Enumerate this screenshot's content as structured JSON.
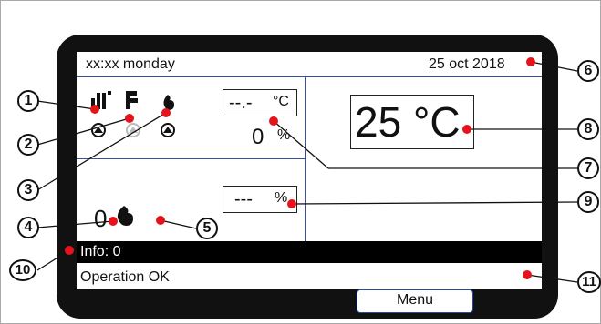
{
  "header": {
    "time_day": "xx:xx monday",
    "date": "25 oct 2018"
  },
  "left_panel": {
    "target_temp": "--.-",
    "target_temp_unit": "°C",
    "modulation_value": "0",
    "modulation_unit": "%",
    "flame_count": "0",
    "power_value": "---",
    "power_unit": "%"
  },
  "right_panel": {
    "actual_temp": "25 °C"
  },
  "info": {
    "line1": "Info: 0",
    "line2": "Operation OK"
  },
  "menu": {
    "label": "Menu"
  },
  "callouts": [
    "1",
    "2",
    "3",
    "4",
    "5",
    "6",
    "7",
    "8",
    "9",
    "10",
    "11"
  ],
  "colors": {
    "marker": "#e3141c",
    "grid": "#3850a0",
    "bezel": "#111111"
  },
  "icons": [
    "radiator-icon",
    "tap-icon",
    "flame-icon",
    "pump-icon",
    "flame-small-icon"
  ]
}
